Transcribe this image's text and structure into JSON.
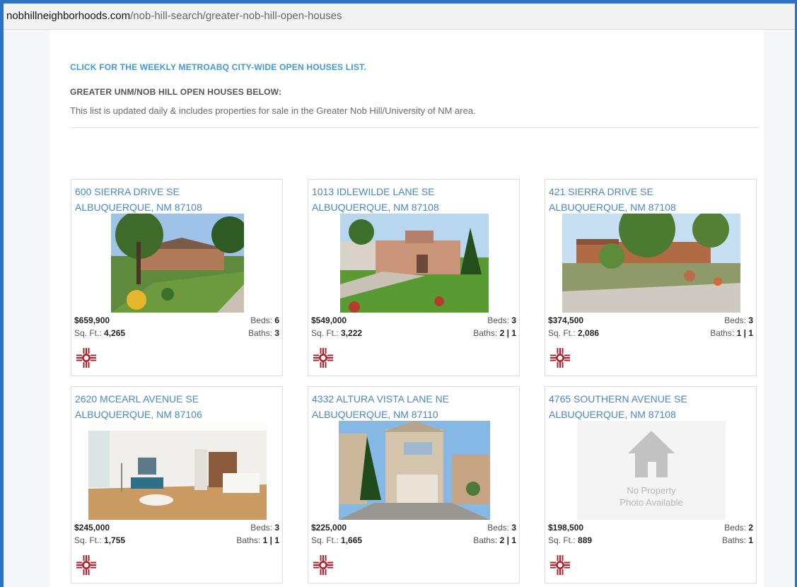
{
  "browser": {
    "url_domain": "nobhillneighborhoods.com",
    "url_path": "/nob-hill-search/greater-nob-hill-open-houses"
  },
  "header": {
    "weekly_link": "CLICK FOR THE WEEKLY METROABQ CITY-WIDE OPEN HOUSES LIST.",
    "heading": "GREATER UNM/NOB HILL OPEN HOUSES BELOW:",
    "description": "This list is updated daily & includes properties for sale in the Greater Nob Hill/University of NM area."
  },
  "labels": {
    "beds": "Beds:",
    "sqft": "Sq. Ft.:",
    "baths": "Baths:",
    "no_photo_line1": "No Property",
    "no_photo_line2": "Photo Available"
  },
  "listings": [
    {
      "street": "600 SIERRA DRIVE SE",
      "city": "ALBUQUERQUE, NM 87108",
      "price": "$659,900",
      "beds": "6",
      "sqft": "4,265",
      "baths": "3"
    },
    {
      "street": "1013 IDLEWILDE LANE SE",
      "city": "ALBUQUERQUE, NM 87108",
      "price": "$549,000",
      "beds": "3",
      "sqft": "3,222",
      "baths": "2 | 1"
    },
    {
      "street": "421 SIERRA DRIVE SE",
      "city": "ALBUQUERQUE, NM 87108",
      "price": "$374,500",
      "beds": "3",
      "sqft": "2,086",
      "baths": "1 | 1"
    },
    {
      "street": "2620 MCEARL AVENUE SE",
      "city": "ALBUQUERQUE, NM 87106",
      "price": "$245,000",
      "beds": "3",
      "sqft": "1,755",
      "baths": "1 | 1"
    },
    {
      "street": "4332 ALTURA VISTA LANE NE",
      "city": "ALBUQUERQUE, NM 87110",
      "price": "$225,000",
      "beds": "3",
      "sqft": "1,665",
      "baths": "2 | 1"
    },
    {
      "street": "4765 SOUTHERN AVENUE SE",
      "city": "ALBUQUERQUE, NM 87108",
      "price": "$198,500",
      "beds": "2",
      "sqft": "889",
      "baths": "1"
    }
  ],
  "colors": {
    "frame": "#2f72c3",
    "link": "#3f9bd6",
    "address": "#4a88c4",
    "logo": "#b3202a"
  }
}
